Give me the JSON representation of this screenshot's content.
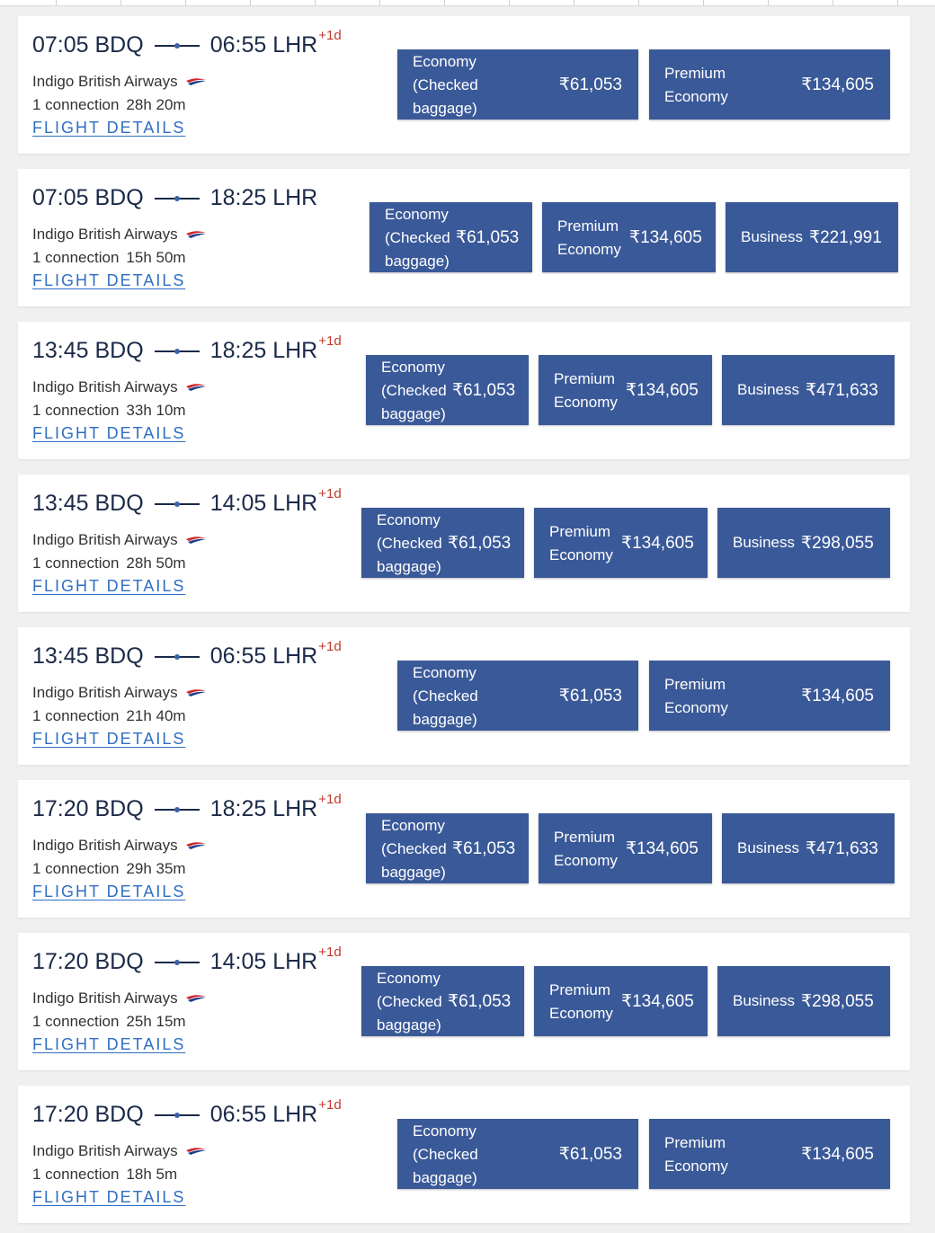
{
  "colors": {
    "fare_button": "#3a5998",
    "link": "#2f6ec4",
    "plus_day": "#c0392b"
  },
  "flights": [
    {
      "depart": "07:05 BDQ",
      "arrive": "06:55 LHR",
      "plus": "+1d",
      "airline": "Indigo British Airways",
      "connection": "1 connection",
      "duration": "28h 20m",
      "details_label": "FLIGHT DETAILS",
      "fares": [
        {
          "label": "Economy\n(Checked\nbaggage)",
          "price": "₹61,053"
        },
        {
          "label": "Premium\nEconomy",
          "price": "₹134,605"
        }
      ]
    },
    {
      "depart": "07:05 BDQ",
      "arrive": "18:25 LHR",
      "plus": "",
      "airline": "Indigo British Airways",
      "connection": "1 connection",
      "duration": "15h 50m",
      "details_label": "FLIGHT DETAILS",
      "fares": [
        {
          "label": "Economy\n(Checked\nbaggage)",
          "price": "₹61,053"
        },
        {
          "label": "Premium\nEconomy",
          "price": "₹134,605"
        },
        {
          "label": "Business",
          "price": "₹221,991"
        }
      ]
    },
    {
      "depart": "13:45 BDQ",
      "arrive": "18:25 LHR",
      "plus": "+1d",
      "airline": "Indigo British Airways",
      "connection": "1 connection",
      "duration": "33h 10m",
      "details_label": "FLIGHT DETAILS",
      "fares": [
        {
          "label": "Economy\n(Checked\nbaggage)",
          "price": "₹61,053"
        },
        {
          "label": "Premium\nEconomy",
          "price": "₹134,605"
        },
        {
          "label": "Business",
          "price": "₹471,633"
        }
      ]
    },
    {
      "depart": "13:45 BDQ",
      "arrive": "14:05 LHR",
      "plus": "+1d",
      "airline": "Indigo British Airways",
      "connection": "1 connection",
      "duration": "28h 50m",
      "details_label": "FLIGHT DETAILS",
      "fares": [
        {
          "label": "Economy\n(Checked\nbaggage)",
          "price": "₹61,053"
        },
        {
          "label": "Premium\nEconomy",
          "price": "₹134,605"
        },
        {
          "label": "Business",
          "price": "₹298,055"
        }
      ]
    },
    {
      "depart": "13:45 BDQ",
      "arrive": "06:55 LHR",
      "plus": "+1d",
      "airline": "Indigo British Airways",
      "connection": "1 connection",
      "duration": "21h 40m",
      "details_label": "FLIGHT DETAILS",
      "fares": [
        {
          "label": "Economy\n(Checked\nbaggage)",
          "price": "₹61,053"
        },
        {
          "label": "Premium\nEconomy",
          "price": "₹134,605"
        }
      ]
    },
    {
      "depart": "17:20 BDQ",
      "arrive": "18:25 LHR",
      "plus": "+1d",
      "airline": "Indigo British Airways",
      "connection": "1 connection",
      "duration": "29h 35m",
      "details_label": "FLIGHT DETAILS",
      "fares": [
        {
          "label": "Economy\n(Checked\nbaggage)",
          "price": "₹61,053"
        },
        {
          "label": "Premium\nEconomy",
          "price": "₹134,605"
        },
        {
          "label": "Business",
          "price": "₹471,633"
        }
      ]
    },
    {
      "depart": "17:20 BDQ",
      "arrive": "14:05 LHR",
      "plus": "+1d",
      "airline": "Indigo British Airways",
      "connection": "1 connection",
      "duration": "25h 15m",
      "details_label": "FLIGHT DETAILS",
      "fares": [
        {
          "label": "Economy\n(Checked\nbaggage)",
          "price": "₹61,053"
        },
        {
          "label": "Premium\nEconomy",
          "price": "₹134,605"
        },
        {
          "label": "Business",
          "price": "₹298,055"
        }
      ]
    },
    {
      "depart": "17:20 BDQ",
      "arrive": "06:55 LHR",
      "plus": "+1d",
      "airline": "Indigo British Airways",
      "connection": "1 connection",
      "duration": "18h 5m",
      "details_label": "FLIGHT DETAILS",
      "fares": [
        {
          "label": "Economy\n(Checked\nbaggage)",
          "price": "₹61,053"
        },
        {
          "label": "Premium\nEconomy",
          "price": "₹134,605"
        }
      ]
    }
  ]
}
